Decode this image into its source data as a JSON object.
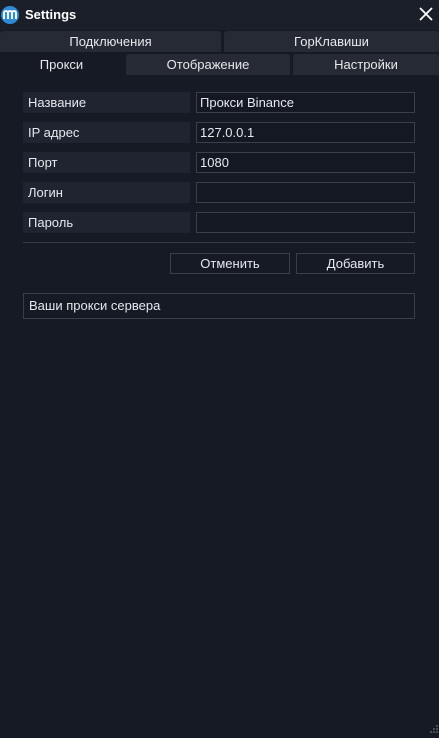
{
  "window": {
    "title": "Settings"
  },
  "tabs": {
    "row1": [
      {
        "label": "Подключения"
      },
      {
        "label": "ГорКлавиши"
      }
    ],
    "row2": [
      {
        "label": "Прокси",
        "active": true
      },
      {
        "label": "Отображение"
      },
      {
        "label": "Настройки"
      }
    ]
  },
  "form": {
    "fields": [
      {
        "label": "Название",
        "value": "Прокси Binance"
      },
      {
        "label": "IP адрес",
        "value": "127.0.0.1"
      },
      {
        "label": "Порт",
        "value": "1080"
      },
      {
        "label": "Логин",
        "value": ""
      },
      {
        "label": "Пароль",
        "value": ""
      }
    ],
    "cancel_label": "Отменить",
    "add_label": "Добавить"
  },
  "proxy_list": {
    "header": "Ваши прокси сервера"
  },
  "icons": {
    "app": "app-logo-icon",
    "close": "close-icon",
    "resize": "resize-grip-icon"
  },
  "colors": {
    "background": "#161a25",
    "tab_inactive": "#252a35",
    "accent": "#2f8bd6"
  }
}
